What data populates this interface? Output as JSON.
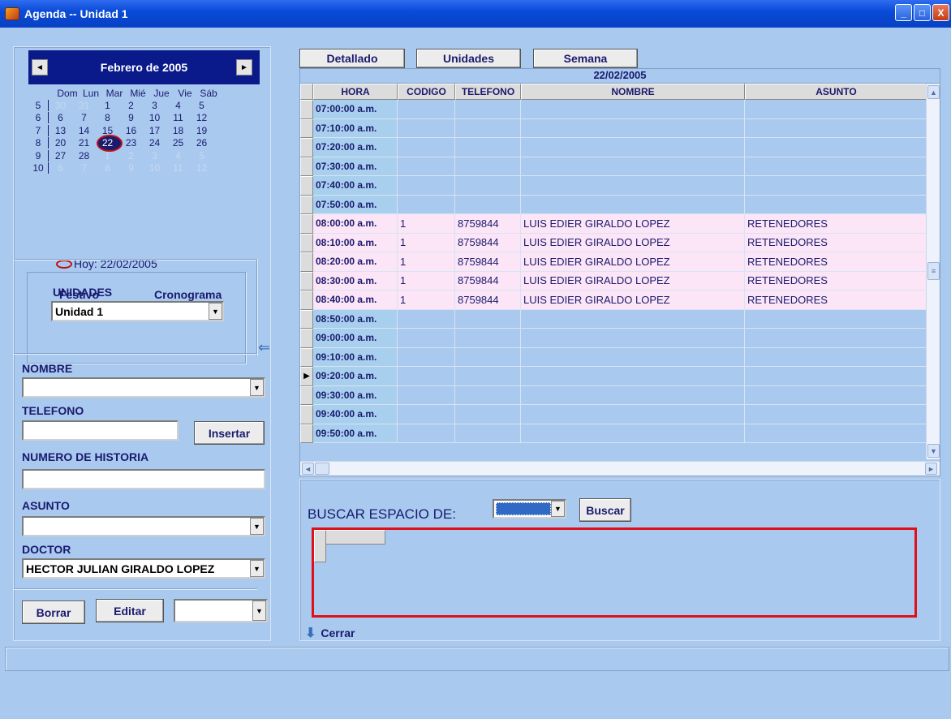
{
  "window": {
    "title": "Agenda -- Unidad 1",
    "buttons": [
      "_",
      "□",
      "X"
    ]
  },
  "calendar": {
    "month_title": "Febrero de 2005",
    "prev": "◄",
    "next": "►",
    "days_of_week": [
      "Dom",
      "Lun",
      "Mar",
      "Mié",
      "Jue",
      "Vie",
      "Sáb"
    ],
    "weeks": [
      {
        "week": "5",
        "days": [
          "30",
          "31",
          "1",
          "2",
          "3",
          "4",
          "5"
        ]
      },
      {
        "week": "6",
        "days": [
          "6",
          "7",
          "8",
          "9",
          "10",
          "11",
          "12"
        ]
      },
      {
        "week": "7",
        "days": [
          "13",
          "14",
          "15",
          "16",
          "17",
          "18",
          "19"
        ]
      },
      {
        "week": "8",
        "days": [
          "20",
          "21",
          "22",
          "23",
          "24",
          "25",
          "26"
        ]
      },
      {
        "week": "9",
        "days": [
          "27",
          "28",
          "1",
          "2",
          "3",
          "4",
          "5"
        ]
      },
      {
        "week": "10",
        "days": [
          "6",
          "7",
          "8",
          "9",
          "10",
          "11",
          "12"
        ]
      }
    ],
    "today_label": "Hoy: 22/02/2005",
    "festivo": "Festivo",
    "cronograma": "Cronograma"
  },
  "unidades": {
    "label": "UNIDADES",
    "selected": "Unidad 1"
  },
  "form": {
    "nombre_label": "NOMBRE",
    "telefono_label": "TELEFONO",
    "insertar": "Insertar",
    "historia_label": "NUMERO DE HISTORIA",
    "asunto_label": "ASUNTO",
    "doctor_label": "DOCTOR",
    "doctor_value": "HECTOR JULIAN GIRALDO LOPEZ",
    "borrar": "Borrar",
    "editar": "Editar"
  },
  "tabs": [
    "Detallado",
    "Unidades",
    "Semana"
  ],
  "grid": {
    "date": "22/02/2005",
    "columns": [
      "HORA",
      "CODIGO",
      "TELEFONO",
      "NOMBRE",
      "ASUNTO"
    ],
    "rows": [
      [
        "07:00:00 a.m.",
        "",
        "",
        "",
        ""
      ],
      [
        "07:10:00 a.m.",
        "",
        "",
        "",
        ""
      ],
      [
        "07:20:00 a.m.",
        "",
        "",
        "",
        ""
      ],
      [
        "07:30:00 a.m.",
        "",
        "",
        "",
        ""
      ],
      [
        "07:40:00 a.m.",
        "",
        "",
        "",
        ""
      ],
      [
        "07:50:00 a.m.",
        "",
        "",
        "",
        ""
      ],
      [
        "08:00:00 a.m.",
        "1",
        "8759844",
        "LUIS EDIER GIRALDO LOPEZ",
        "RETENEDORES"
      ],
      [
        "08:10:00 a.m.",
        "1",
        "8759844",
        "LUIS EDIER GIRALDO LOPEZ",
        "RETENEDORES"
      ],
      [
        "08:20:00 a.m.",
        "1",
        "8759844",
        "LUIS EDIER GIRALDO LOPEZ",
        "RETENEDORES"
      ],
      [
        "08:30:00 a.m.",
        "1",
        "8759844",
        "LUIS EDIER GIRALDO LOPEZ",
        "RETENEDORES"
      ],
      [
        "08:40:00 a.m.",
        "1",
        "8759844",
        "LUIS EDIER GIRALDO LOPEZ",
        "RETENEDORES"
      ],
      [
        "08:50:00 a.m.",
        "",
        "",
        "",
        ""
      ],
      [
        "09:00:00 a.m.",
        "",
        "",
        "",
        ""
      ],
      [
        "09:10:00 a.m.",
        "",
        "",
        "",
        ""
      ],
      [
        "09:20:00 a.m.",
        "",
        "",
        "",
        ""
      ],
      [
        "09:30:00 a.m.",
        "",
        "",
        "",
        ""
      ],
      [
        "09:40:00 a.m.",
        "",
        "",
        "",
        ""
      ],
      [
        "09:50:00 a.m.",
        "",
        "",
        "",
        ""
      ]
    ],
    "current_row_marker": "▶"
  },
  "search": {
    "label": "BUSCAR ESPACIO DE:",
    "buscar": "Buscar",
    "cerrar": "Cerrar"
  },
  "colors": {
    "background": "#a9c9ef",
    "booked_row": "#fbe5f6",
    "titlebar": "#0a4bd8",
    "highlight": "#e0101a"
  }
}
